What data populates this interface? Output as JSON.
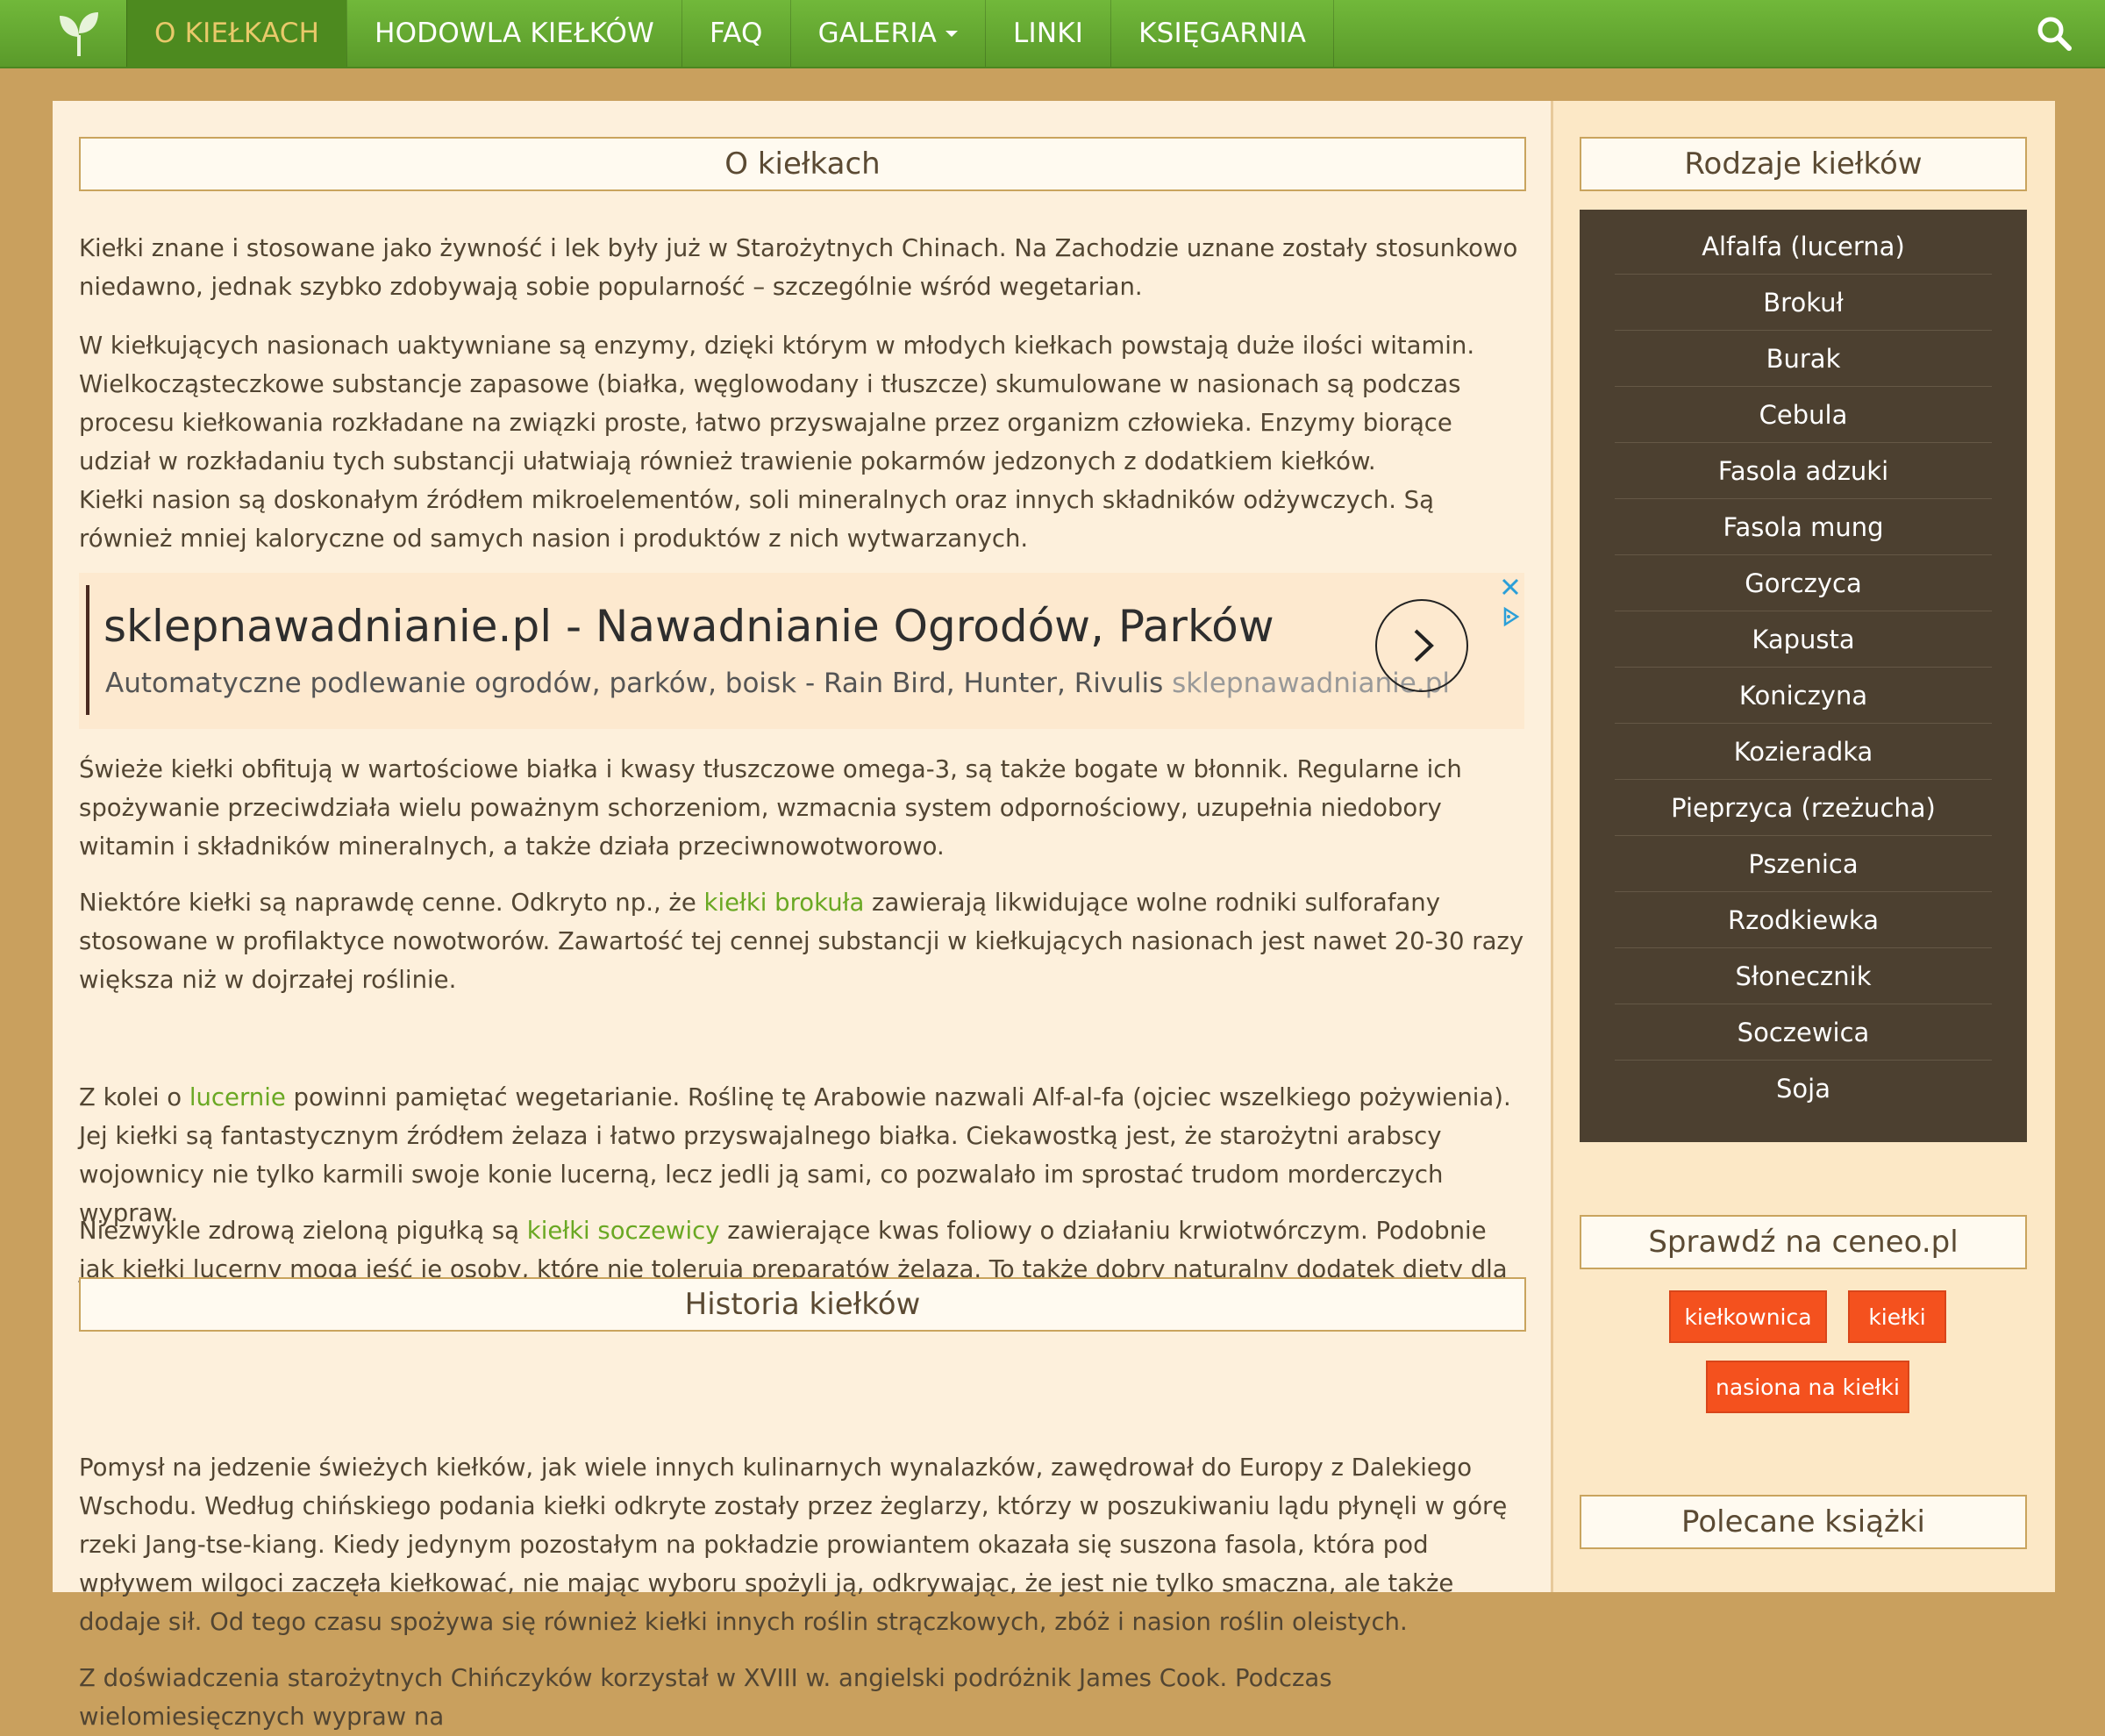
{
  "nav": {
    "items": [
      "O KIEŁKACH",
      "HODOWLA KIEŁKÓW",
      "FAQ",
      "GALERIA",
      "LINKI",
      "KSIĘGARNIA"
    ]
  },
  "main": {
    "title1": "O kiełkach",
    "p1": "Kiełki znane i stosowane jako żywność i lek były już w Starożytnych Chinach. Na Zachodzie uznane zostały stosunkowo niedawno, jednak szybko zdobywają sobie popularność – szczególnie wśród wegetarian.",
    "p2a": "W kiełkujących nasionach uaktywniane są enzymy, dzięki którym w młodych kiełkach powstają duże ilości witamin. Wielkocząsteczkowe substancje zapasowe (białka, węglowodany i tłuszcze) skumulowane w nasionach są podczas procesu kiełkowania rozkładane na związki proste, łatwo przyswajalne przez organizm człowieka. Enzymy biorące udział w rozkładaniu tych substancji ułatwiają również trawienie pokarmów jedzonych z dodatkiem kiełków.",
    "p2b": "Kiełki nasion są doskonałym źródłem mikroelementów, soli mineralnych oraz innych składników odżywczych. Są również mniej kaloryczne od samych nasion i produktów z nich wytwarzanych.",
    "p3": "Świeże kiełki obfitują w wartościowe białka i kwasy tłuszczowe omega-3, są także bogate w błonnik. Regularne ich spożywanie przeciwdziała wielu poważnym schorzeniom, wzmacnia system odpornościowy, uzupełnia niedobory witamin i składników mineralnych, a także działa przeciwnowotworowo.",
    "p4_pre": "Niektóre kiełki są naprawdę cenne. Odkryto np., że ",
    "p4_link": "kiełki brokuła",
    "p4_post": " zawierają likwidujące wolne rodniki sulforafany stosowane w profilaktyce nowotworów. Zawartość tej cennej substancji w kiełkujących nasionach jest nawet 20-30 razy większa niż w dojrzałej roślinie.",
    "p5_pre": "Z kolei o ",
    "p5_link": "lucernie",
    "p5_post": " powinni pamiętać wegetarianie. Roślinę tę Arabowie nazwali Alf-al-fa (ojciec wszelkiego pożywienia). Jej kiełki są fantastycznym źródłem żelaza i łatwo przyswajalnego białka. Ciekawostką jest, że starożytni arabscy wojownicy nie tylko karmili swoje konie lucerną, lecz jedli ją sami, co pozwalało im sprostać trudom morderczych wypraw.",
    "p6_pre": "Niezwykle zdrową zieloną pigułką są ",
    "p6_link": "kiełki soczewicy",
    "p6_post": " zawierające kwas foliowy o działaniu krwiotwórczym. Podobnie jak kiełki lucerny mogą jeść je osoby, które nie tolerują preparatów żelaza. To także dobry naturalny dodatek diety dla kobiet w ciąży – kwas foliowy niezbędny jest w procesach kształtowania systemu nerwowego przyszłego dziecka.",
    "title2": "Historia kiełków",
    "p7": "Pomysł na jedzenie świeżych kiełków, jak wiele innych kulinarnych wynalazków, zawędrował do Europy z Dalekiego Wschodu. Według chińskiego podania kiełki odkryte zostały przez żeglarzy, którzy w poszukiwaniu lądu płynęli w górę rzeki Jang-tse-kiang. Kiedy jedynym pozostałym na pokładzie prowiantem okazała się suszona fasola, która pod wpływem wilgoci zaczęła kiełkować, nie mając wyboru spożyli ją, odkrywając, że jest nie tylko smaczna, ale także dodaje sił. Od tego czasu spożywa się również kiełki innych roślin strączkowych, zbóż i nasion roślin oleistych.",
    "p8": "Z doświadczenia starożytnych Chińczyków korzystał w XVIII w. angielski podróżnik James Cook. Podczas wielomiesięcznych wypraw na"
  },
  "ad": {
    "title": "sklepnawadnianie.pl - Nawadnianie Ogrodów, Parków",
    "desc": "Automatyczne podlewanie ogrodów, parków, boisk - Rain Bird, Hunter, Rivulis",
    "domain": "sklepnawadnianie.pl"
  },
  "sidebar": {
    "title1": "Rodzaje kiełków",
    "sprouts": [
      "Alfalfa (lucerna)",
      "Brokuł",
      "Burak",
      "Cebula",
      "Fasola adzuki",
      "Fasola mung",
      "Gorczyca",
      "Kapusta",
      "Koniczyna",
      "Kozieradka",
      "Pieprzyca (rzeżucha)",
      "Pszenica",
      "Rzodkiewka",
      "Słonecznik",
      "Soczewica",
      "Soja"
    ],
    "title2": "Sprawdź na ceneo.pl",
    "tags": [
      "kiełkownica",
      "kiełki",
      "nasiona na kiełki"
    ],
    "title3": "Polecane książki"
  },
  "colors": {
    "nav_green": "#5a9a2a",
    "link_green": "#6aa823",
    "tag_orange": "#f4511e",
    "list_bg": "#4c4030"
  }
}
